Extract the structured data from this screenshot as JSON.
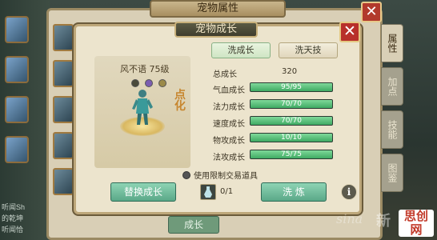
{
  "window": {
    "title": "宠物属性",
    "side_tabs": [
      "属性",
      "加点",
      "技能",
      "图鉴"
    ],
    "bottom_label": "成长"
  },
  "dialog": {
    "title": "宠物成长",
    "tabs": [
      "洗成长",
      "洗天技"
    ],
    "pet": {
      "name": "风不语 75级",
      "mark": "点化"
    },
    "stats": {
      "total_label": "总成长",
      "total_value": "320",
      "rows": [
        {
          "label": "气血成长",
          "value": "95/95",
          "fill": 1.0
        },
        {
          "label": "法力成长",
          "value": "70/70",
          "fill": 1.0
        },
        {
          "label": "速度成长",
          "value": "70/70",
          "fill": 1.0
        },
        {
          "label": "物攻成长",
          "value": "10/10",
          "fill": 1.0
        },
        {
          "label": "法攻成长",
          "value": "75/75",
          "fill": 1.0
        }
      ]
    },
    "checkbox_label": "使用限制交易道具",
    "replace_button": "替换成长",
    "wash_button": "洗 炼",
    "item_count": "0/1",
    "info_symbol": "i"
  },
  "background": {
    "chat_lines": [
      "听闻Sh",
      "的乾坤",
      "听闻恰"
    ]
  },
  "watermark": {
    "latin": "sina",
    "cn": "新",
    "brand": "思创网"
  },
  "colors": {
    "accent_green": "#5aa888",
    "bar_fill": "#3faa63",
    "close_red": "#b8302a"
  }
}
